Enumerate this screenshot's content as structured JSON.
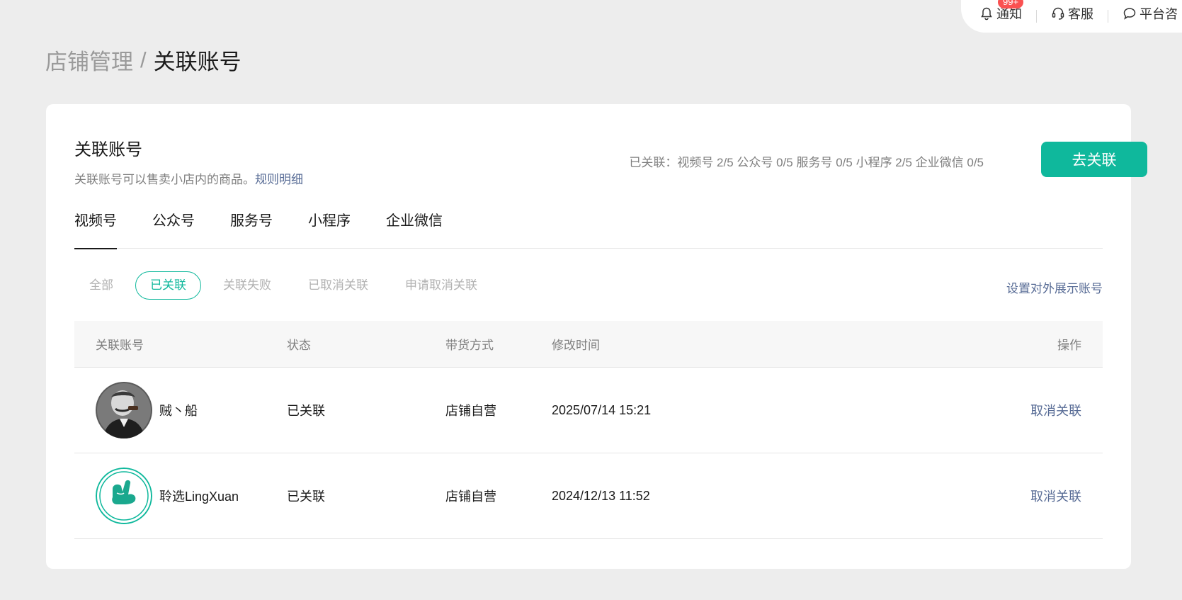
{
  "topbar": {
    "notify_label": "通知",
    "notify_badge": "99+",
    "service_label": "客服",
    "platform_label": "平台咨"
  },
  "breadcrumb": {
    "parent": "店铺管理",
    "separator": "/",
    "current": "关联账号"
  },
  "card": {
    "title": "关联账号",
    "description": "关联账号可以售卖小店内的商品。",
    "rules_link": "规则明细",
    "summary": "已关联：视频号 2/5 公众号 0/5 服务号 0/5 小程序 2/5 企业微信 0/5",
    "primary_button": "去关联"
  },
  "tabs": [
    {
      "label": "视频号",
      "active": true
    },
    {
      "label": "公众号",
      "active": false
    },
    {
      "label": "服务号",
      "active": false
    },
    {
      "label": "小程序",
      "active": false
    },
    {
      "label": "企业微信",
      "active": false
    }
  ],
  "filters": [
    {
      "label": "全部",
      "active": false
    },
    {
      "label": "已关联",
      "active": true
    },
    {
      "label": "关联失败",
      "active": false
    },
    {
      "label": "已取消关联",
      "active": false
    },
    {
      "label": "申请取消关联",
      "active": false
    }
  ],
  "display_link": "设置对外展示账号",
  "table": {
    "headers": [
      "关联账号",
      "状态",
      "带货方式",
      "修改时间",
      "操作"
    ],
    "rows": [
      {
        "name": "贼丶船",
        "status": "已关联",
        "mode": "店铺自营",
        "time": "2025/07/14 15:21",
        "action": "取消关联",
        "avatar": "portrait-avatar"
      },
      {
        "name": "聆选LingXuan",
        "status": "已关联",
        "mode": "店铺自营",
        "time": "2024/12/13 11:52",
        "action": "取消关联",
        "avatar": "green-logo-avatar"
      }
    ]
  },
  "colors": {
    "accent": "#0fb89c",
    "link": "#576b95",
    "badge": "#fa5151"
  }
}
